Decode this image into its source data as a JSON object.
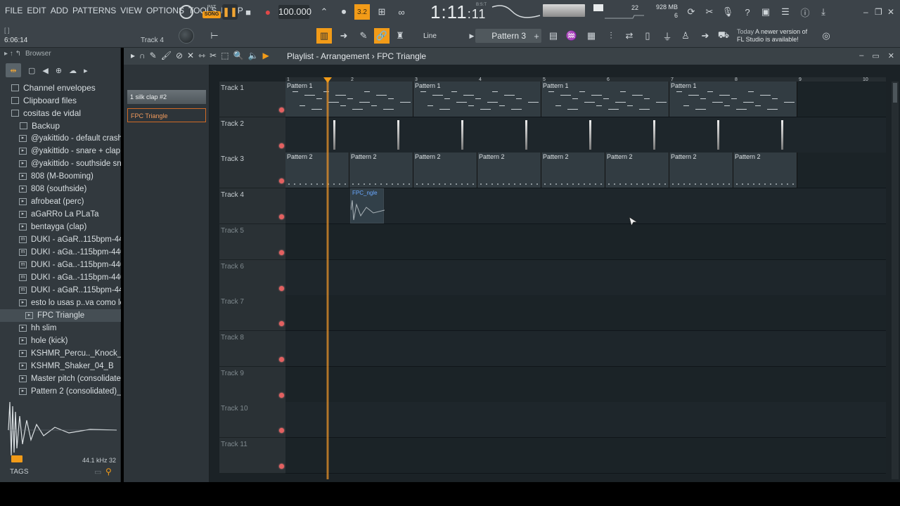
{
  "menu": [
    "FILE",
    "EDIT",
    "ADD",
    "PATTERNS",
    "VIEW",
    "OPTIONS",
    "TOOLS",
    "HELP"
  ],
  "transport": {
    "pat_label": "PAT",
    "song_label": "SONG",
    "tempo": "100.000",
    "time": "1:11",
    "time_small": ":11",
    "bst": "B:S:T",
    "snap_btn": "3.2"
  },
  "system": {
    "cpu": "22",
    "mem_top": "928 MB",
    "mem_bottom": "6"
  },
  "status": {
    "hint": "[ ]",
    "position": "6:06:14",
    "track": "Track 4"
  },
  "toolbar": {
    "snap": "Line",
    "pattern": "Pattern 3",
    "add_pattern": "+"
  },
  "news": {
    "line1_muted": "Today",
    "line1": "A newer version of",
    "line2": "FL Studio is available!"
  },
  "browser": {
    "title": "Browser",
    "items": [
      {
        "label": "Channel envelopes",
        "kind": "folder"
      },
      {
        "label": "Clipboard files",
        "kind": "folder"
      },
      {
        "label": "cositas de vidal",
        "kind": "folder"
      },
      {
        "label": "Backup",
        "kind": "folder"
      },
      {
        "label": "@yakittido - default crash",
        "kind": "file"
      },
      {
        "label": "@yakittido - snare + clap",
        "kind": "file"
      },
      {
        "label": "@yakittido - southside snare",
        "kind": "file"
      },
      {
        "label": "808 (M-Booming)",
        "kind": "file"
      },
      {
        "label": "808 (southside)",
        "kind": "file"
      },
      {
        "label": "afrobeat (perc)",
        "kind": "file"
      },
      {
        "label": "aGaRRo La PLaTa",
        "kind": "file"
      },
      {
        "label": "bentayga (clap)",
        "kind": "file"
      },
      {
        "label": "DUKI - aGaR..115bpm-440hz",
        "kind": "mp3"
      },
      {
        "label": "DUKI - aGa..-115bpm-440hz",
        "kind": "mp3"
      },
      {
        "label": "DUKI - aGa..-115bpm-440hz",
        "kind": "mp3"
      },
      {
        "label": "DUKI - aGa..-115bpm-440hz",
        "kind": "mp3"
      },
      {
        "label": "DUKI - aGaR..115bpm-440hz",
        "kind": "mp3"
      },
      {
        "label": "esto lo usas p..va como loco",
        "kind": "file"
      },
      {
        "label": "FPC Triangle",
        "kind": "file",
        "selected": true
      },
      {
        "label": "hh slim",
        "kind": "file"
      },
      {
        "label": "hole (kick)",
        "kind": "file"
      },
      {
        "label": "KSHMR_Percu.._Knock_02_D",
        "kind": "file"
      },
      {
        "label": "KSHMR_Shaker_04_B",
        "kind": "file"
      },
      {
        "label": "Master pitch (consolidated)",
        "kind": "file"
      },
      {
        "label": "Pattern 2 (consolidated)_4",
        "kind": "file"
      }
    ],
    "sample_rate": "44.1 kHz",
    "bit_depth": "32",
    "tags": "TAGS"
  },
  "playlist": {
    "title": "Playlist - Arrangement",
    "sep": "›",
    "current": "FPC Triangle",
    "picker": [
      {
        "label": "1 silk clap #2"
      },
      {
        "label": "FPC Triangle"
      }
    ],
    "ruler": [
      "1",
      "2",
      "3",
      "4",
      "5",
      "6",
      "7",
      "8",
      "9",
      "10"
    ],
    "tracks": [
      "Track 1",
      "Track 2",
      "Track 3",
      "Track 4",
      "Track 5",
      "Track 6",
      "Track 7",
      "Track 8",
      "Track 9",
      "Track 10",
      "Track 11"
    ],
    "track1_clips": [
      "Pattern 1",
      "Pattern 1",
      "Pattern 1",
      "Pattern 1"
    ],
    "track3_clips": [
      "Pattern 2",
      "Pattern 2",
      "Pattern 2",
      "Pattern 2",
      "Pattern 2",
      "Pattern 2",
      "Pattern 2",
      "Pattern 2"
    ],
    "track4_clip": "FPC_ngle"
  },
  "colors": {
    "accent": "#f29b18",
    "track_bg": "#1b2327",
    "browser_bg": "#32393e"
  }
}
